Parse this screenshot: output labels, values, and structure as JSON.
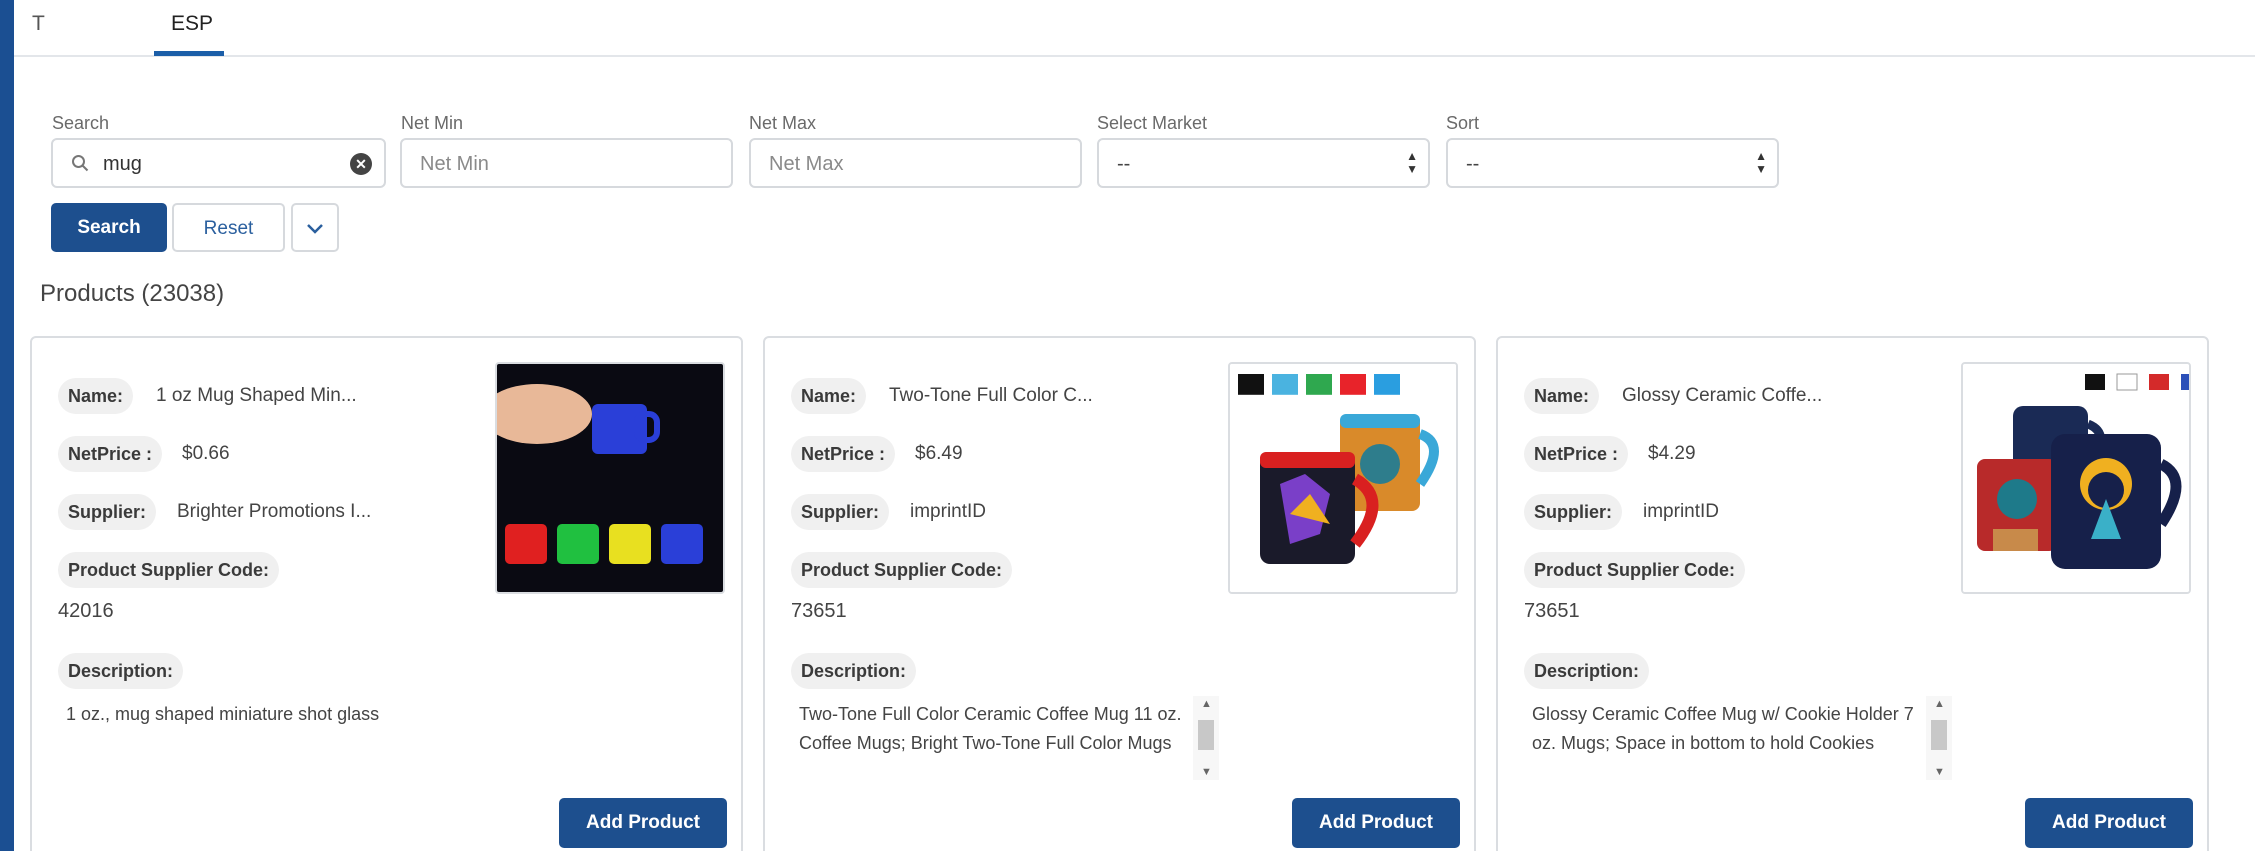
{
  "tabs": [
    {
      "label": "T"
    },
    {
      "label": "ESP"
    }
  ],
  "filters": {
    "search": {
      "label": "Search",
      "value": "mug"
    },
    "net_min": {
      "label": "Net Min",
      "placeholder": "Net Min"
    },
    "net_max": {
      "label": "Net Max",
      "placeholder": "Net Max"
    },
    "market": {
      "label": "Select Market",
      "selected": "--"
    },
    "sort": {
      "label": "Sort",
      "selected": "--"
    }
  },
  "buttons": {
    "search": "Search",
    "reset": "Reset"
  },
  "products_title": "Products (23038)",
  "field_labels": {
    "name": "Name:",
    "net_price": "NetPrice :",
    "supplier": "Supplier:",
    "supplier_code": "Product Supplier Code:",
    "description": "Description:"
  },
  "products": [
    {
      "name": "1 oz Mug Shaped Min...",
      "net_price": "$0.66",
      "supplier": "Brighter Promotions I...",
      "code": "42016",
      "description": "1 oz., mug shaped miniature shot glass",
      "add_label": "Add Product",
      "swatches": []
    },
    {
      "name": "Two-Tone Full Color C...",
      "net_price": "$6.49",
      "supplier": "imprintID",
      "code": "73651",
      "description": "Two-Tone Full Color Ceramic Coffee Mug 11 oz. Coffee Mugs; Bright Two-Tone Full Color Mugs",
      "add_label": "Add Product",
      "swatches": [
        "#111111",
        "#4ab3e0",
        "#2fa84f",
        "#e8232a",
        "#2a9ee0"
      ]
    },
    {
      "name": "Glossy Ceramic Coffe...",
      "net_price": "$4.29",
      "supplier": "imprintID",
      "code": "73651",
      "description": "Glossy Ceramic Coffee Mug w/ Cookie Holder 7 oz. Mugs; Space in bottom to hold Cookies",
      "add_label": "Add Product",
      "swatches": [
        "#111111",
        "#ffffff",
        "#d42a2a",
        "#2b4fb8"
      ]
    }
  ],
  "colors": {
    "primary": "#1d4f8e",
    "frame": "#1b4f92"
  }
}
